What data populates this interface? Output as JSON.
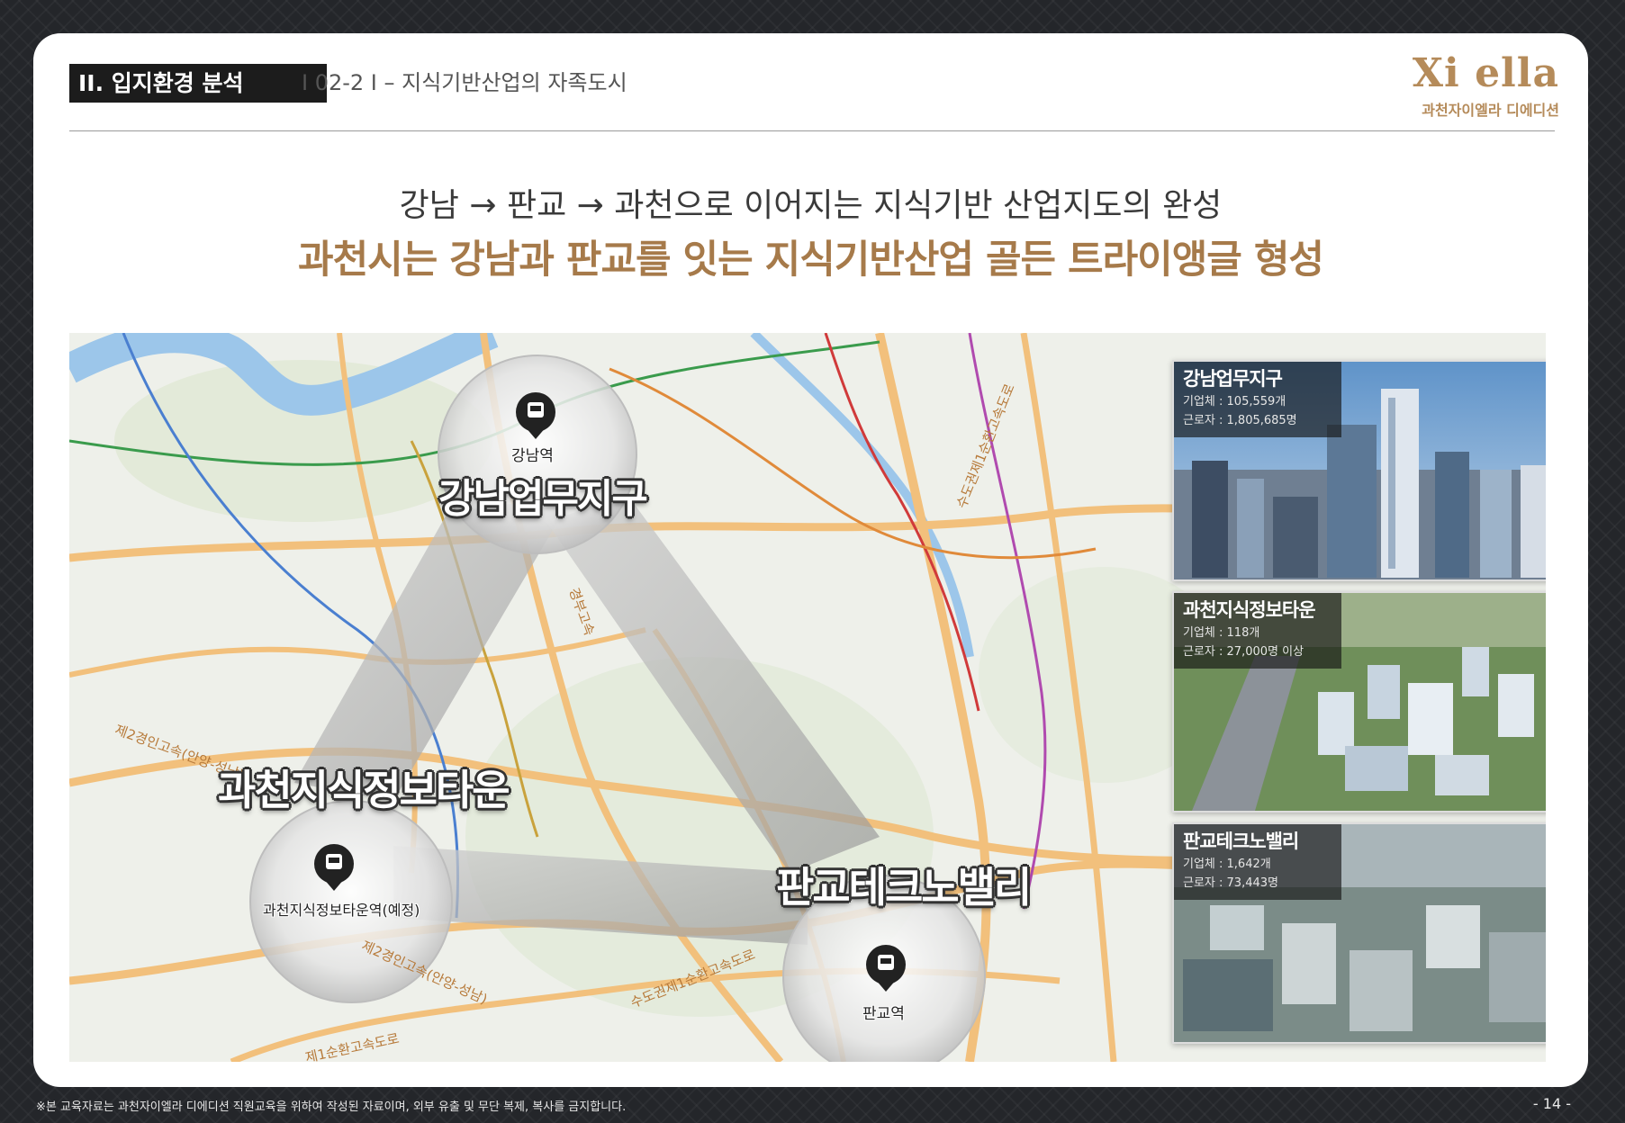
{
  "header": {
    "section": "II. 입지환경 분석",
    "subtitle": "I 02-2 I – 지식기반산업의 자족도시",
    "logo_mark": "Xi ella",
    "logo_sub": "과천자이엘라 디에디션"
  },
  "headline": {
    "line1": "강남 → 판교 → 과천으로 이어지는 지식기반 산업지도의 완성",
    "line2": "과천시는 강남과 판교를 잇는 지식기반산업 골든 트라이앵글 형성"
  },
  "map": {
    "regions": [
      {
        "label": "강남업무지구",
        "station": "강남역"
      },
      {
        "label": "과천지식정보타운",
        "station": "과천지식정보타운역(예정)"
      },
      {
        "label": "판교테크노밸리",
        "station": "판교역"
      }
    ],
    "road_labels": [
      "수도권제1순환고속도로",
      "제2경인고속(안양-성남)",
      "제2경인고속(안양-성남)",
      "수도권제1순환고속도로",
      "제1순환고속도로",
      "경부고속"
    ]
  },
  "cards": [
    {
      "title": "강남업무지구",
      "companies": "기업체 : 105,559개",
      "workers": "근로자 : 1,805,685명"
    },
    {
      "title": "과천지식정보타운",
      "companies": "기업체 : 118개",
      "workers": "근로자 : 27,000명 이상"
    },
    {
      "title": "판교테크노밸리",
      "companies": "기업체 : 1,642개",
      "workers": "근로자 : 73,443명"
    }
  ],
  "footer": {
    "note": "※본 교육자료는 과천자이엘라 디에디션 직원교육을 위하여 작성된 자료이며, 외부 유출 및 무단 복제, 복사를 금지합니다.",
    "page": "- 14 -"
  },
  "colors": {
    "accent": "#a67a4a",
    "dark": "#1c1c1c",
    "road": "#f2c07c"
  }
}
